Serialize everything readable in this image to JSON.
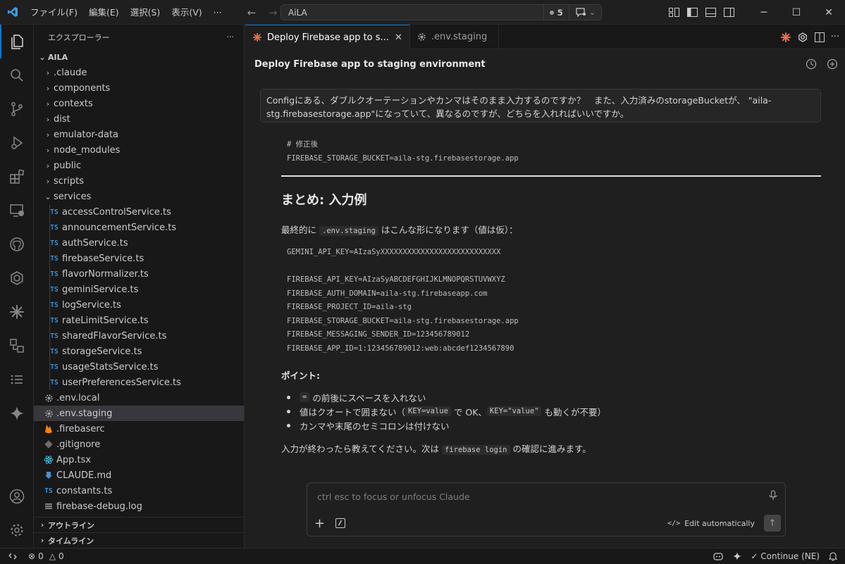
{
  "menu": [
    "ファイル(F)",
    "編集(E)",
    "選択(S)",
    "表示(V)",
    "···"
  ],
  "command_center": {
    "text": "AiLA",
    "badge_count": "5"
  },
  "sidebar": {
    "title": "エクスプローラー",
    "more": "···",
    "root": "AILA",
    "folders": [
      ".claude",
      "components",
      "contexts",
      "dist",
      "emulator-data",
      "node_modules",
      "public",
      "scripts"
    ],
    "open_folder": "services",
    "service_files": [
      "accessControlService.ts",
      "announcementService.ts",
      "authService.ts",
      "firebaseService.ts",
      "flavorNormalizer.ts",
      "geminiService.ts",
      "logService.ts",
      "rateLimitService.ts",
      "sharedFlavorService.ts",
      "storageService.ts",
      "usageStatsService.ts",
      "userPreferencesService.ts"
    ],
    "root_files": [
      {
        "name": ".env.local",
        "icon": "gear-icon"
      },
      {
        "name": ".env.staging",
        "icon": "gear-icon"
      },
      {
        "name": ".firebaserc",
        "icon": "firebase-icon"
      },
      {
        "name": ".gitignore",
        "icon": "git-icon"
      },
      {
        "name": "App.tsx",
        "icon": "react-icon"
      },
      {
        "name": "CLAUDE.md",
        "icon": "download-arrow-icon"
      },
      {
        "name": "constants.ts",
        "icon": "ts-icon"
      },
      {
        "name": "firebase-debug.log",
        "icon": "lines-icon"
      }
    ],
    "ts_label": "TS",
    "outline": "アウトライン",
    "timeline": "タイムライン"
  },
  "tabs": [
    {
      "label": "Deploy Firebase app to s...",
      "close": "✕"
    },
    {
      "label": ".env.staging"
    }
  ],
  "chat": {
    "title": "Deploy Firebase app to staging environment",
    "user_message": "Configにある、ダブルクオーテーションやカンマはそのまま入力するのですか？　また、入力済みのstorageBucketが、 \"aila-stg.firebasestorage.app\"になっていて、異なるのですが、どちらを入れればいいですか。",
    "code1": [
      "# 修正後",
      "FIREBASE_STORAGE_BUCKET=aila-stg.firebasestorage.app"
    ],
    "heading": "まとめ: 入力例",
    "summary_pre": "最終的に",
    "summary_code": ".env.staging",
    "summary_post": "はこんな形になります（値は仮）：",
    "code2a": "GEMINI_API_KEY=AIzaSyXXXXXXXXXXXXXXXXXXXXXXXXXXX",
    "code2b": [
      "FIREBASE_API_KEY=AIzaSyABCDEFGHIJKLMNOPQRSTUVWXYZ",
      "FIREBASE_AUTH_DOMAIN=aila-stg.firebaseapp.com",
      "FIREBASE_PROJECT_ID=aila-stg",
      "FIREBASE_STORAGE_BUCKET=aila-stg.firebasestorage.app",
      "FIREBASE_MESSAGING_SENDER_ID=123456789012",
      "FIREBASE_APP_ID=1:123456789012:web:abcdef1234567890"
    ],
    "points_title": "ポイント:",
    "b1_code": "=",
    "b1_text": "の前後にスペースを入れない",
    "b2_pre": "値はクオートで囲まない（",
    "b2_code1": "KEY=value",
    "b2_mid": "で OK、",
    "b2_code2": "KEY=\"value\"",
    "b2_post": "も動くが不要）",
    "b3": "カンマや末尾のセミコロンは付けない",
    "final_pre": "入力が終わったら教えてください。次は",
    "final_code": "firebase login",
    "final_post": "の確認に進みます。"
  },
  "input": {
    "placeholder": "ctrl esc to focus or unfocus Claude",
    "plus": "+",
    "edit_mode": "Edit automatically",
    "send": "↑"
  },
  "status": {
    "errors": "0",
    "warnings": "0",
    "continue": "Continue (NE)"
  },
  "colors": {
    "accent": "#0078d4",
    "ts": "#3d8fd6",
    "claude": "#e8704a"
  }
}
